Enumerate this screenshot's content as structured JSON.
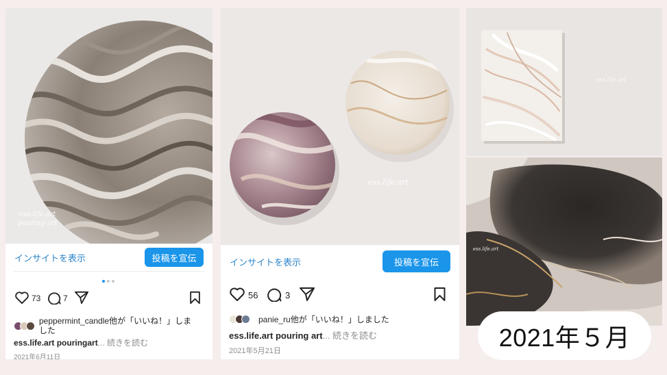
{
  "posts": [
    {
      "watermark_line1": "ess.life.art",
      "watermark_line2": "pouring art",
      "insight_label": "インサイトを表示",
      "promote_label": "投稿を宣伝",
      "likes": "73",
      "comments": "7",
      "liked_by": "peppermint_candle他が「いいね！」しました",
      "caption_user": "ess.life.art",
      "caption_text": "pouringart",
      "more_label": "... 続きを読む",
      "date": "2021年6月11日"
    },
    {
      "watermark_line1": "ess.life.art",
      "insight_label": "インサイトを表示",
      "promote_label": "投稿を宣伝",
      "likes": "56",
      "comments": "3",
      "liked_by": "panie_ru他が「いいね！」しました",
      "caption_user": "ess.life.art",
      "caption_text": "pouring art",
      "more_label": "... 続きを読む",
      "date": "2021年5月21日"
    }
  ],
  "art3_watermark": "ess.life.art",
  "art4_watermark": "ess.life.art",
  "month_label": "2021年５月",
  "colors": {
    "accent": "#1a95ea",
    "link": "#2b84c9",
    "background": "#f6eded"
  },
  "icons": [
    "heart-icon",
    "comment-icon",
    "share-icon",
    "bookmark-icon"
  ]
}
